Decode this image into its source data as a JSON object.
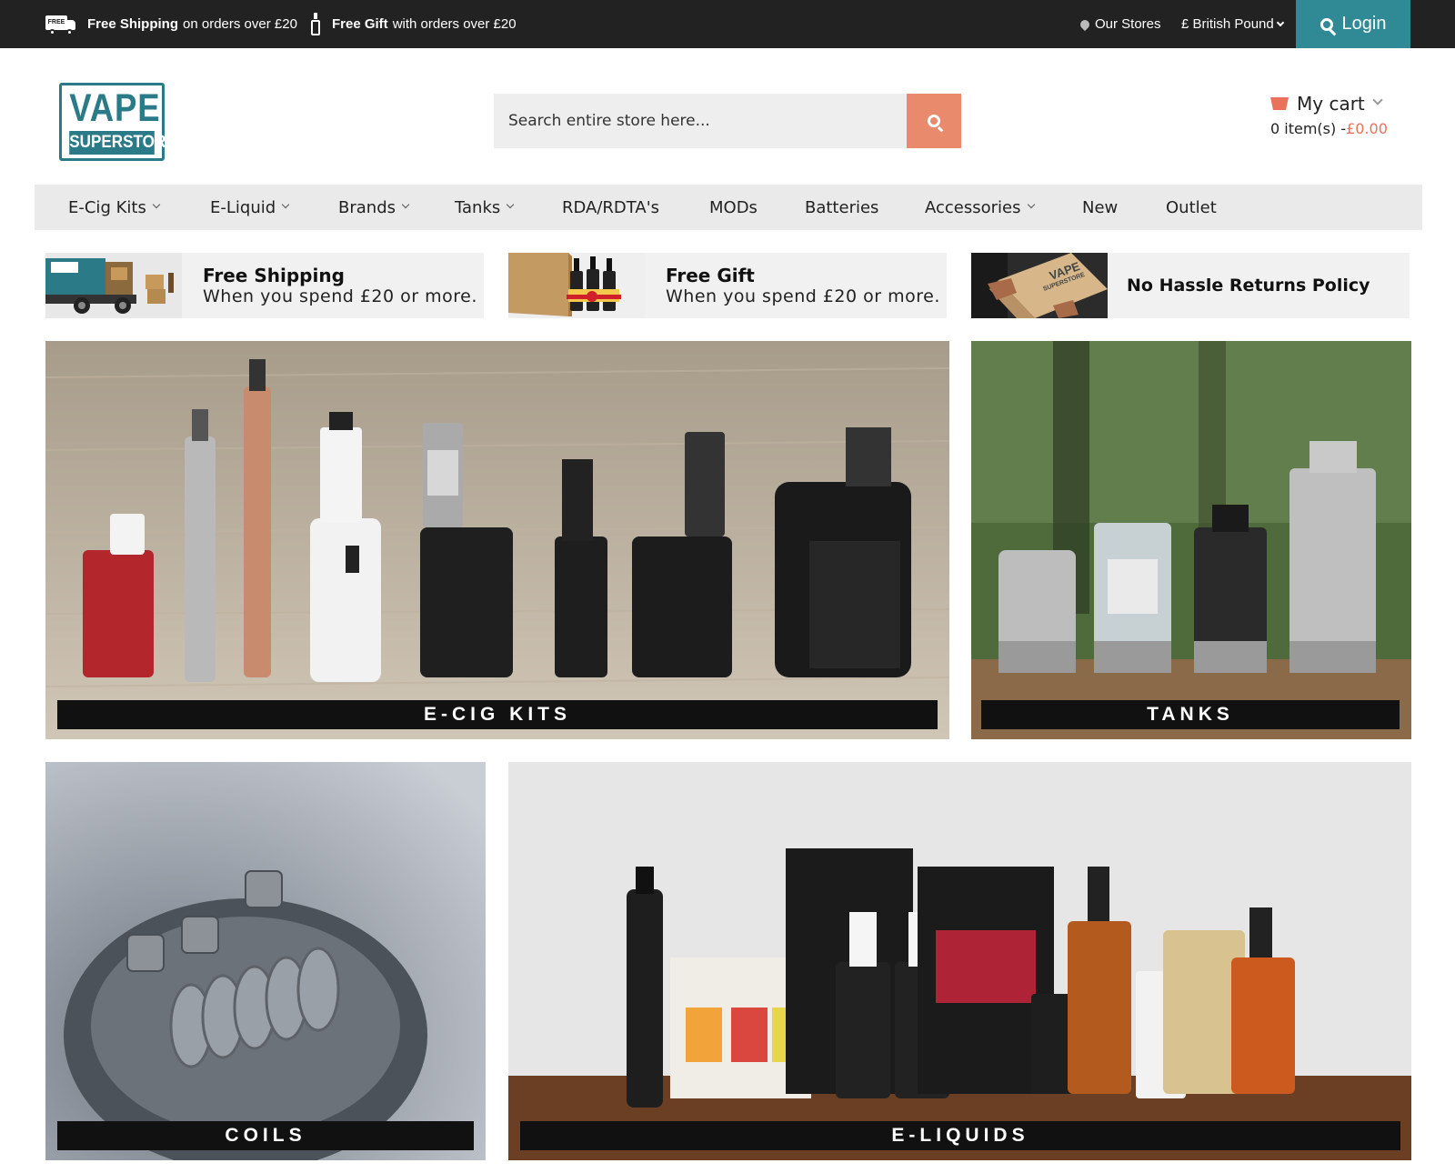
{
  "topbar": {
    "shipping_bold": "Free Shipping",
    "shipping_rest": "on orders over £20",
    "truck_badge": "FREE",
    "gift_bold": "Free Gift",
    "gift_rest": "with orders over £20",
    "stores": "Our Stores",
    "currency": "£ British Pound",
    "login": "Login"
  },
  "header": {
    "logo_line1": "VAPE",
    "logo_line2": "SUPERSTORE",
    "search_placeholder": "Search entire store here...",
    "cart_label": "My cart",
    "cart_items": "0 item(s) -",
    "cart_total": "£0.00"
  },
  "nav": [
    {
      "label": "E-Cig Kits",
      "dropdown": true
    },
    {
      "label": "E-Liquid",
      "dropdown": true
    },
    {
      "label": "Brands",
      "dropdown": true
    },
    {
      "label": "Tanks",
      "dropdown": true
    },
    {
      "label": "RDA/RDTA's",
      "dropdown": false
    },
    {
      "label": "MODs",
      "dropdown": false
    },
    {
      "label": "Batteries",
      "dropdown": false
    },
    {
      "label": "Accessories",
      "dropdown": true
    },
    {
      "label": "New",
      "dropdown": false
    },
    {
      "label": "Outlet",
      "dropdown": false
    }
  ],
  "features": [
    {
      "title": "Free Shipping",
      "subtitle": "When you spend £20 or more."
    },
    {
      "title": "Free Gift",
      "subtitle": "When you spend £20 or more."
    },
    {
      "title": "No Hassle Returns Policy",
      "box_text_1": "VAPE",
      "box_text_2": "SUPERSTORE"
    }
  ],
  "categories": [
    {
      "label": "E-CIG KITS"
    },
    {
      "label": "TANKS"
    },
    {
      "label": "COILS"
    },
    {
      "label": "E-LIQUIDS"
    }
  ],
  "colors": {
    "topbar": "#222222",
    "login": "#2f8a96",
    "accent": "#e98a6d",
    "logo": "#2a7a87"
  }
}
